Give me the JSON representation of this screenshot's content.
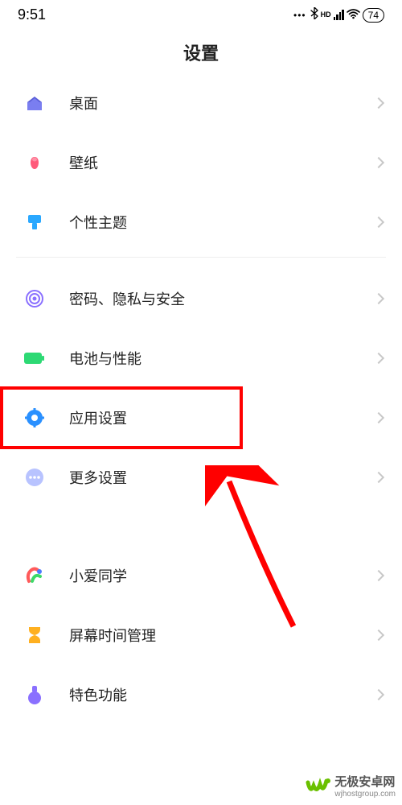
{
  "status": {
    "time": "9:51",
    "battery": "74"
  },
  "title": "设置",
  "items": {
    "desktop": "桌面",
    "wallpaper": "壁纸",
    "theme": "个性主题",
    "security": "密码、隐私与安全",
    "battery": "电池与性能",
    "apps": "应用设置",
    "more": "更多设置",
    "xiaoai": "小爱同学",
    "screentime": "屏幕时间管理",
    "special": "特色功能"
  },
  "watermark": {
    "line1": "无极安卓网",
    "line2": "wjhostgroup.com"
  }
}
